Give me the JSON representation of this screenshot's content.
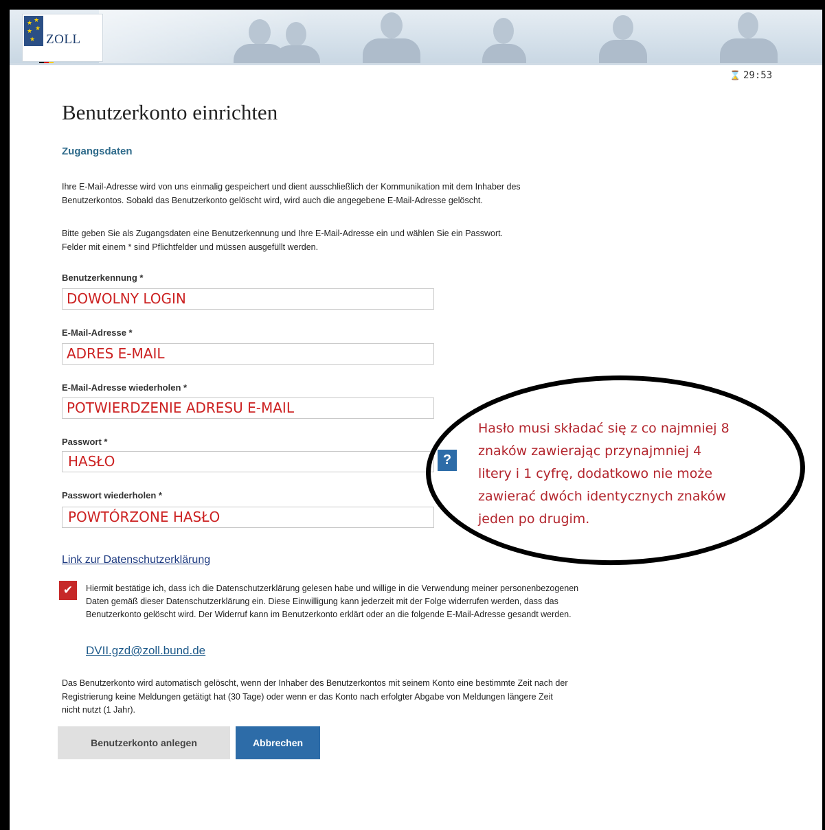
{
  "header": {
    "logo_text": "ZOLL"
  },
  "timer": {
    "icon": "hourglass-icon",
    "value": "29:53"
  },
  "page": {
    "title": "Benutzerkonto einrichten",
    "section_heading": "Zugangsdaten",
    "intro_line1": "Ihre E-Mail-Adresse wird von uns einmalig gespeichert und dient ausschließlich der Kommunikation mit dem Inhaber des",
    "intro_line2": "Benutzerkontos. Sobald das Benutzerkonto gelöscht wird, wird auch die angegebene E-Mail-Adresse gelöscht.",
    "instructions_line1": "Bitte geben Sie als Zugangsdaten eine Benutzerkennung und Ihre E-Mail-Adresse ein und wählen Sie ein Passwort.",
    "instructions_line2": "Felder mit einem * sind Pflichtfelder und müssen ausgefüllt werden."
  },
  "form": {
    "username": {
      "label": "Benutzerkennung *",
      "value": "DOWOLNY LOGIN"
    },
    "email": {
      "label": "E-Mail-Adresse *",
      "value": "ADRES E-MAIL"
    },
    "email_repeat": {
      "label": "E-Mail-Adresse wiederholen *",
      "value": "POTWIERDZENIE ADRESU E-MAIL"
    },
    "password": {
      "label": "Passwort *",
      "value": "HASŁO"
    },
    "password_repeat": {
      "label": "Passwort wiederholen *",
      "value": "POWTÓRZONE HASŁO"
    },
    "help_label": "?"
  },
  "annotation": {
    "line1": "Hasło musi składać się z co najmniej 8",
    "line2": "znaków  zawierając przynajmniej 4",
    "line3": "litery i 1 cyfrę, dodatkowo nie może",
    "line4": "zawierać dwóch identycznych znaków",
    "line5": "jeden po drugim."
  },
  "privacy": {
    "link_text": "Link zur Datenschutzerklärung",
    "checkbox_checked": true,
    "consent_line1": "Hiermit bestätige ich, dass ich die Datenschutzerklärung gelesen habe und willige in die Verwendung meiner personenbezogenen",
    "consent_line2": "Daten gemäß dieser Datenschutzerklärung ein. Diese Einwilligung kann jederzeit mit der Folge widerrufen werden, dass das",
    "consent_line3": "Benutzerkonto gelöscht wird. Der Widerruf kann im Benutzerkonto erklärt oder an die folgende E-Mail-Adresse gesandt werden.",
    "contact_email": "DVII.gzd@zoll.bund.de"
  },
  "deletion_notice": {
    "line1": "Das Benutzerkonto wird automatisch gelöscht, wenn der Inhaber des Benutzerkontos mit seinem Konto eine bestimmte Zeit nach der",
    "line2": "Registrierung keine Meldungen getätigt hat (30 Tage) oder wenn er das Konto nach erfolgter Abgabe von Meldungen längere Zeit",
    "line3": "nicht nutzt (1 Jahr)."
  },
  "buttons": {
    "create": "Benutzerkonto anlegen",
    "cancel": "Abbrechen"
  },
  "colors": {
    "accent_blue": "#2d6ca8",
    "heading_teal": "#2f6b8b",
    "annotation_red": "#b3262e",
    "checkbox_red": "#c62828"
  }
}
